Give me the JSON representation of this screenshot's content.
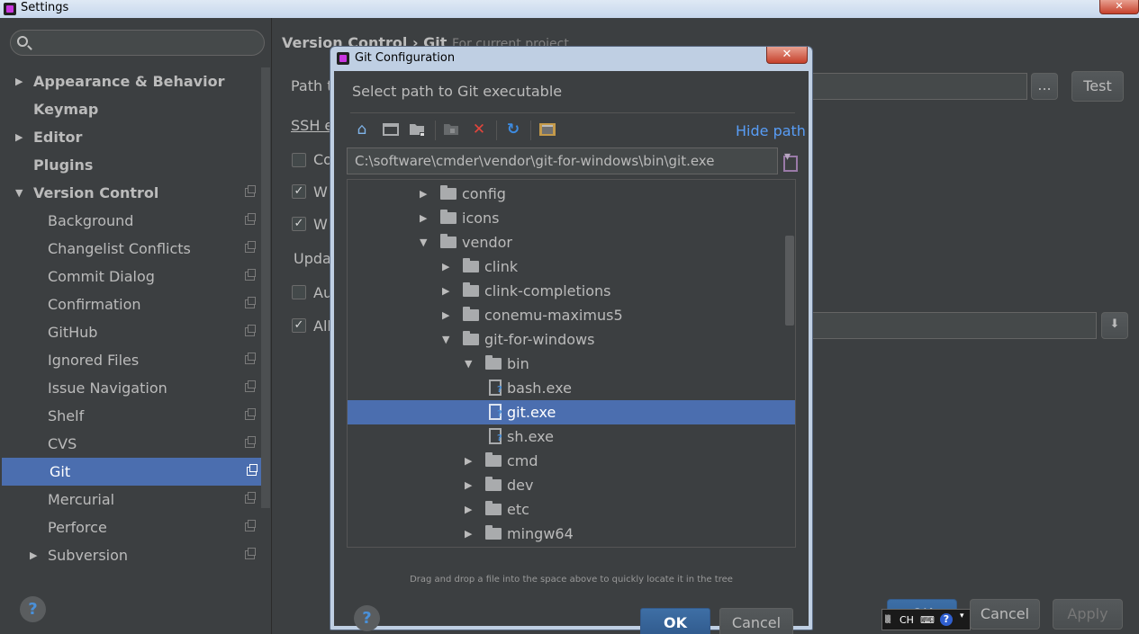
{
  "window": {
    "title": "Settings"
  },
  "search": {
    "placeholder": ""
  },
  "sidebar": {
    "items": [
      {
        "label": "Appearance & Behavior",
        "expandable": true,
        "expanded": false
      },
      {
        "label": "Keymap"
      },
      {
        "label": "Editor",
        "expandable": true,
        "expanded": false
      },
      {
        "label": "Plugins"
      },
      {
        "label": "Version Control",
        "expandable": true,
        "expanded": true
      },
      {
        "label": "Background"
      },
      {
        "label": "Changelist Conflicts"
      },
      {
        "label": "Commit Dialog"
      },
      {
        "label": "Confirmation"
      },
      {
        "label": "GitHub"
      },
      {
        "label": "Ignored Files"
      },
      {
        "label": "Issue Navigation"
      },
      {
        "label": "Shelf"
      },
      {
        "label": "CVS"
      },
      {
        "label": "Git",
        "selected": true
      },
      {
        "label": "Mercurial"
      },
      {
        "label": "Perforce"
      },
      {
        "label": "Subversion",
        "expandable": true,
        "expanded": false
      }
    ],
    "help_label": "?"
  },
  "content": {
    "breadcrumb": {
      "section": "Version Control",
      "separator": "›",
      "page": "Git",
      "scope": "For current project"
    },
    "path_label": "Path t",
    "ssh_label": "SSH e",
    "check1_label": "Co",
    "check2_label": "W",
    "check3_label": "W",
    "update_label": "Upda",
    "check4_label": "Au",
    "check5_label": "All",
    "browse_label": "...",
    "test_label": "Test",
    "ok_label": "OK",
    "cancel_label": "Cancel",
    "apply_label": "Apply"
  },
  "dialog": {
    "title": "Git Configuration",
    "close_label": "✕",
    "heading": "Select path to Git executable",
    "toolbar": {
      "icons": [
        "home-icon",
        "desktop-icon",
        "project-folder-icon",
        "new-folder-icon",
        "delete-icon",
        "refresh-icon",
        "show-hidden-icon"
      ],
      "hide_path_label": "Hide path"
    },
    "path_value": "C:\\software\\cmder\\vendor\\git-for-windows\\bin\\git.exe",
    "tree": [
      {
        "name": "config",
        "type": "folder",
        "depth": 0,
        "expanded": false
      },
      {
        "name": "icons",
        "type": "folder",
        "depth": 0,
        "expanded": false
      },
      {
        "name": "vendor",
        "type": "folder",
        "depth": 0,
        "expanded": true
      },
      {
        "name": "clink",
        "type": "folder",
        "depth": 1,
        "expanded": false
      },
      {
        "name": "clink-completions",
        "type": "folder",
        "depth": 1,
        "expanded": false
      },
      {
        "name": "conemu-maximus5",
        "type": "folder",
        "depth": 1,
        "expanded": false
      },
      {
        "name": "git-for-windows",
        "type": "folder",
        "depth": 1,
        "expanded": true
      },
      {
        "name": "bin",
        "type": "folder",
        "depth": 2,
        "expanded": true
      },
      {
        "name": "bash.exe",
        "type": "file",
        "depth": 3
      },
      {
        "name": "git.exe",
        "type": "file",
        "depth": 3,
        "selected": true
      },
      {
        "name": "sh.exe",
        "type": "file",
        "depth": 3
      },
      {
        "name": "cmd",
        "type": "folder",
        "depth": 2,
        "expanded": false
      },
      {
        "name": "dev",
        "type": "folder",
        "depth": 2,
        "expanded": false
      },
      {
        "name": "etc",
        "type": "folder",
        "depth": 2,
        "expanded": false
      },
      {
        "name": "mingw64",
        "type": "folder",
        "depth": 2,
        "expanded": false
      }
    ],
    "drag_hint": "Drag and drop a file into the space above to quickly locate it in the tree",
    "help_label": "?",
    "ok_label": "OK",
    "cancel_label": "Cancel"
  },
  "ime": {
    "mode": "CH"
  },
  "colors": {
    "background": "#3c3f41",
    "selection": "#4b6eaf",
    "link": "#589df6",
    "accent": "#c936e0"
  }
}
